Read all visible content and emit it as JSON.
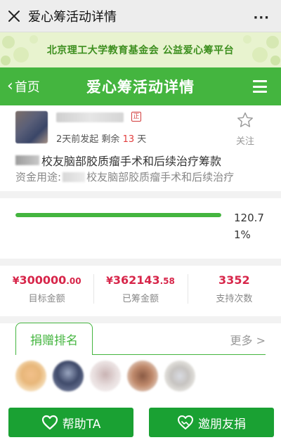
{
  "topbar": {
    "title": "爱心筹活动详情",
    "more": "···",
    "close_icon": "close-icon"
  },
  "banner": {
    "text": "北京理工大学教育基金会 公益爱心筹平台"
  },
  "nav": {
    "back_label": "首页",
    "title": "爱心筹活动详情",
    "menu_icon": "menu-icon"
  },
  "organizer": {
    "verify_badge": "正",
    "started": "2天前发起",
    "remaining_prefix": "剩余",
    "remaining_days": "13",
    "remaining_suffix": "天",
    "follow_label": "关注"
  },
  "project": {
    "title": "校友脑部胶质瘤手术和后续治疗筹款",
    "usage_label": "资金用途:",
    "usage_text": "校友脑部胶质瘤手术和后续治疗"
  },
  "progress": {
    "percent_text": "120.71%",
    "fill_fraction": 1.0
  },
  "stats": [
    {
      "currency": "¥",
      "int": "300000",
      "dec": ".00",
      "label": "目标金额"
    },
    {
      "currency": "¥",
      "int": "362143",
      "dec": ".58",
      "label": "已筹金额"
    },
    {
      "currency": "",
      "int": "3352",
      "dec": "",
      "label": "支持次数"
    }
  ],
  "ranking": {
    "tab_label": "捐赠排名",
    "more_label": "更多 >"
  },
  "footer": {
    "help_label": "帮助TA",
    "invite_label": "邀朋友捐"
  },
  "colors": {
    "brand_green": "#44b53f",
    "button_green": "#1aa133",
    "amount_red": "#d7264a"
  }
}
